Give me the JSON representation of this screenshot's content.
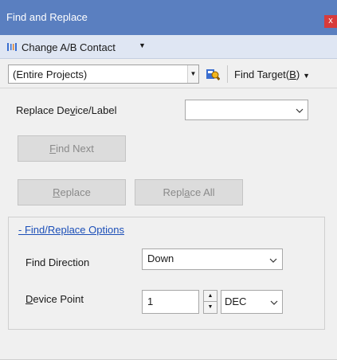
{
  "window": {
    "title": "Find and Replace",
    "close_glyph": "x"
  },
  "toolbar": {
    "change_ab_label": "Change A/B Contact",
    "change_ab_icon": "ab-contact-icon",
    "scope_value": "(Entire Projects)",
    "find_target_icon": "find-target-icon",
    "find_target_prefix": "Find Target(",
    "find_target_key": "B",
    "find_target_suffix": ")"
  },
  "form": {
    "replace_device_label_a": "Replace De",
    "replace_device_label_key": "v",
    "replace_device_label_b": "ice/Label",
    "replace_device_value": "",
    "find_next": {
      "key": "F",
      "rest": "ind Next"
    },
    "replace": {
      "key": "R",
      "rest": "eplace"
    },
    "replace_all": {
      "a": "Repl",
      "key": "a",
      "b": "ce All"
    }
  },
  "options": {
    "title": "- Find/Replace Options",
    "find_direction_label": "Find Direction",
    "find_direction_value": "Down",
    "device_point_key": "D",
    "device_point_rest": "evice Point",
    "device_point_value": "1",
    "radix_value": "DEC"
  },
  "colors": {
    "titlebar": "#5a7fc0",
    "toolbar": "#dfe6f3",
    "close": "#d83b3b",
    "link": "#1c4fb8"
  }
}
